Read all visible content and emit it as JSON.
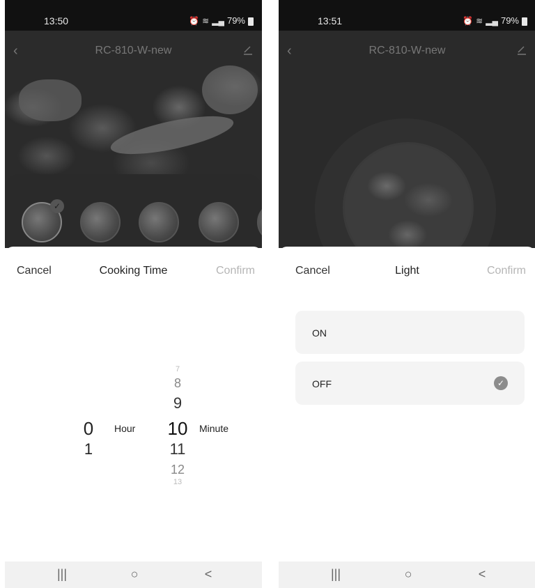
{
  "left": {
    "status": {
      "time": "13:50",
      "battery": "79%"
    },
    "header": {
      "title": "RC-810-W-new"
    },
    "sheet": {
      "cancel_label": "Cancel",
      "title": "Cooking Time",
      "confirm_label": "Confirm",
      "hour_values": [
        "0",
        "1"
      ],
      "hour_unit": "Hour",
      "minute_values": [
        "7",
        "8",
        "9",
        "10",
        "11",
        "12",
        "13"
      ],
      "minute_unit": "Minute"
    }
  },
  "right": {
    "status": {
      "time": "13:51",
      "battery": "79%"
    },
    "header": {
      "title": "RC-810-W-new"
    },
    "sheet": {
      "cancel_label": "Cancel",
      "title": "Light",
      "confirm_label": "Confirm",
      "options": [
        {
          "label": "ON",
          "selected": false
        },
        {
          "label": "OFF",
          "selected": true
        }
      ]
    }
  },
  "system_nav": {
    "recents": "|||",
    "home": "○",
    "back": "<"
  }
}
